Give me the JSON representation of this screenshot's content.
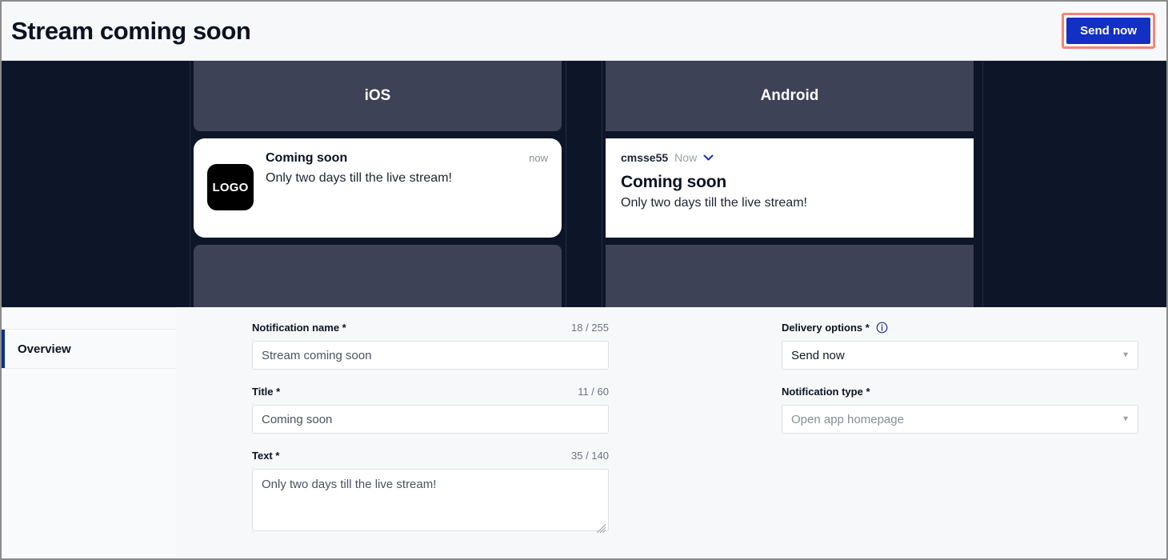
{
  "header": {
    "title": "Stream coming soon",
    "send_button_label": "Send now"
  },
  "preview": {
    "ios": {
      "platform_label": "iOS",
      "logo_text": "LOGO",
      "title": "Coming soon",
      "text": "Only two days till the live stream!",
      "time": "now"
    },
    "android": {
      "platform_label": "Android",
      "app_name": "cmsse55",
      "time": "Now",
      "title": "Coming soon",
      "text": "Only two days till the live stream!"
    }
  },
  "sidebar": {
    "items": [
      {
        "label": "Overview",
        "active": true
      }
    ]
  },
  "form": {
    "notification_name": {
      "label": "Notification name *",
      "counter": "18 / 255",
      "value": "Stream coming soon"
    },
    "title": {
      "label": "Title *",
      "counter": "11 / 60",
      "value": "Coming soon"
    },
    "text": {
      "label": "Text *",
      "counter": "35 / 140",
      "value": "Only two days till the live stream!"
    },
    "delivery_options": {
      "label": "Delivery options *",
      "value": "Send now"
    },
    "notification_type": {
      "label": "Notification type *",
      "value": "Open app homepage"
    }
  },
  "colors": {
    "accent_blue": "#1330c4",
    "highlight_red": "#f98176",
    "preview_bg": "#0d1628",
    "panel_slate": "#3d4257",
    "sidebar_active": "#0f2e8c"
  }
}
